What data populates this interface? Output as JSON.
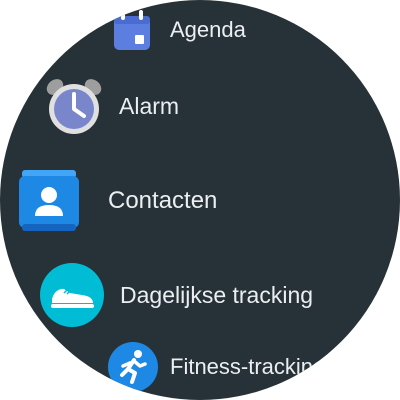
{
  "apps": [
    {
      "id": "agenda",
      "label": "Agenda",
      "icon": "calendar-icon",
      "color": "#5c7ee0"
    },
    {
      "id": "alarm",
      "label": "Alarm",
      "icon": "alarm-clock-icon",
      "color": "#7986cb"
    },
    {
      "id": "contacts",
      "label": "Contacten",
      "icon": "contacts-icon",
      "color": "#1e88e5"
    },
    {
      "id": "tracking",
      "label": "Dagelijkse tracking",
      "icon": "sneaker-icon",
      "color": "#00bcd4"
    },
    {
      "id": "fitness",
      "label": "Fitness-tracking",
      "icon": "runner-icon",
      "color": "#1e88e5"
    }
  ],
  "colors": {
    "background": "#263238",
    "text": "#eceff1"
  }
}
